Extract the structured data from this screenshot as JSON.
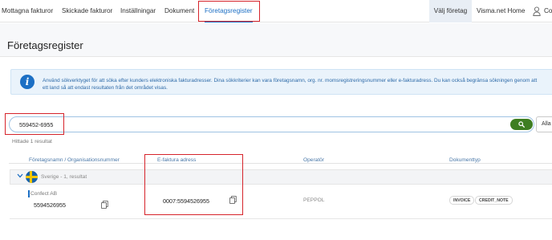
{
  "nav": {
    "items": [
      {
        "label": "Mottagna fakturor"
      },
      {
        "label": "Skickade fakturor"
      },
      {
        "label": "Inställningar"
      },
      {
        "label": "Dokument"
      },
      {
        "label": "Företagsregister",
        "active": true
      }
    ],
    "choose_company": "Välj företag",
    "visma_home": "Visma.net Home",
    "user_partial": "Co",
    "user_icon": "user-icon"
  },
  "page": {
    "title": "Företagsregister"
  },
  "info": {
    "icon": "info-icon",
    "line1": "Använd sökverktyget för att söka efter kunders elektroniska fakturadresser. Dina sökkriterier kan vara företagsnamn, org. nr. momsregistreringsnummer eller e-fakturadress. Du kan också begränsa sökningen genom att",
    "line2": "ett land så att endast resultaten från det området visas."
  },
  "search": {
    "value": "559452-6955",
    "button_icon": "search-icon",
    "filter_label": "Alla l"
  },
  "results": {
    "count_label": "Hittade 1 resultat"
  },
  "table": {
    "headers": {
      "company": "Företagsnamn / Organisationsnummer",
      "einvoice": "E-faktura adress",
      "operator": "Operatör",
      "doctype": "Dokumenttyp"
    },
    "group": {
      "label": "Sverige - 1, resultat",
      "flag": "sweden-flag"
    },
    "rows": [
      {
        "company_name": "Confect AB",
        "org_number": "5594526955",
        "einvoice_address": "0007:5594526955",
        "operator": "PEPPOL",
        "doc_types": [
          "INVOICE",
          "CREDIT_NOTE"
        ]
      }
    ]
  },
  "colors": {
    "accent": "#1c6fc4",
    "highlight": "#d6242b",
    "search_button": "#3e7e22"
  }
}
